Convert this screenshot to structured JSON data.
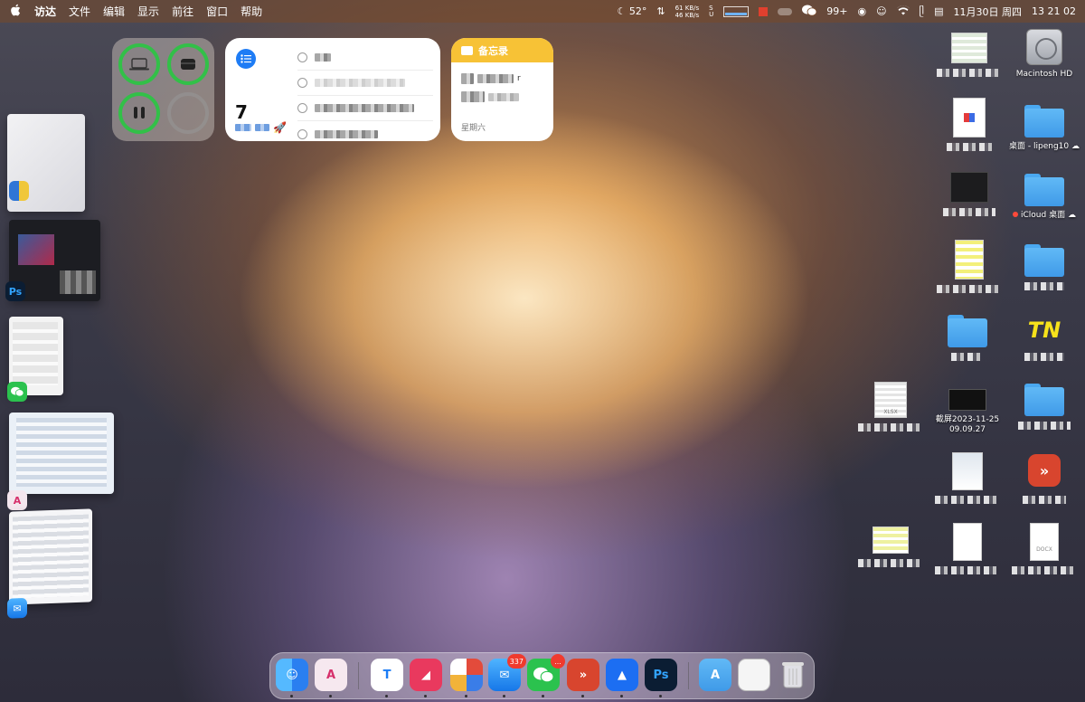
{
  "menubar": {
    "apple_icon": "apple-logo-icon",
    "app_name": "访达",
    "menus": [
      "文件",
      "编辑",
      "显示",
      "前往",
      "窗口",
      "帮助"
    ],
    "weather": "52°",
    "net_up": "61 KB/s",
    "net_down": "46 KB/s",
    "wechat_badge": "99+",
    "date": "11月30日 周四",
    "time": "13 21 02"
  },
  "widgets": {
    "reminders": {
      "count": "7"
    },
    "notes": {
      "title": "备忘录",
      "day": "星期六",
      "note_char": "r"
    }
  },
  "desktop": {
    "macintosh_hd": "Macintosh HD",
    "desktop_folder": "桌面 - lipeng10",
    "icloud_desktop": "iCloud 桌面",
    "screenshot_name": "截屏2023-11-25 09.09.27",
    "xlsx_label": "XLSX",
    "docx_label": "DOCX"
  },
  "dock": {
    "mail_badge": "337",
    "wechat_badge": "..."
  },
  "colors": {
    "ring_green": "#32c048",
    "reminders_blue": "#1e7cf5",
    "notes_yellow": "#f7c236",
    "folder_blue": "#4aa8f0",
    "badge_red": "#f03a2e"
  }
}
